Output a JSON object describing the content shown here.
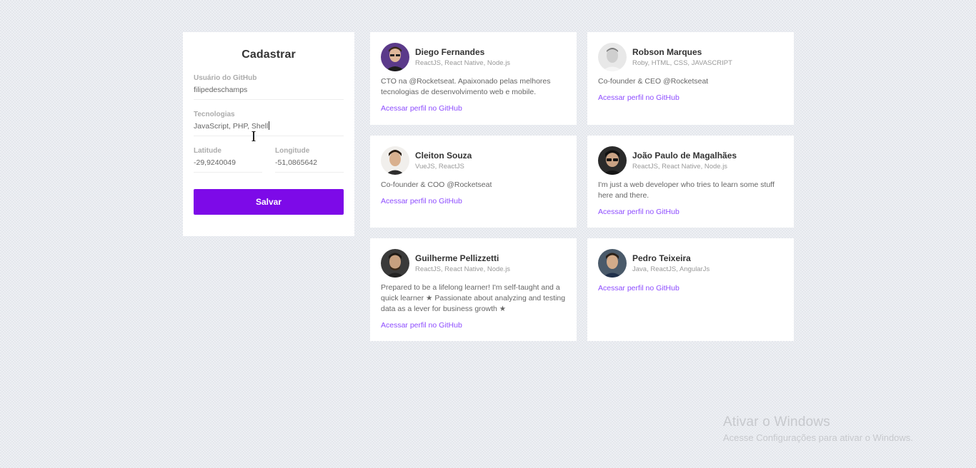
{
  "form": {
    "title": "Cadastrar",
    "github_user_label": "Usuário do GitHub",
    "github_user_value": "filipedeschamps",
    "techs_label": "Tecnologias",
    "techs_value": "JavaScript, PHP, Shell",
    "latitude_label": "Latitude",
    "latitude_value": "-29,9240049",
    "longitude_label": "Longitude",
    "longitude_value": "-51,0865642",
    "save_label": "Salvar"
  },
  "devs": [
    {
      "name": "Diego Fernandes",
      "techs": "ReactJS, React Native, Node.js",
      "bio": "CTO na @Rocketseat. Apaixonado pelas melhores tecnologias de desenvolvimento web e mobile.",
      "link": "Acessar perfil no GitHub"
    },
    {
      "name": "Robson Marques",
      "techs": "Roby, HTML, CSS, JAVASCRIPT",
      "bio": "Co-founder & CEO @Rocketseat",
      "link": "Acessar perfil no GitHub"
    },
    {
      "name": "Cleiton Souza",
      "techs": "VueJS, ReactJS",
      "bio": "Co-founder & COO @Rocketseat",
      "link": "Acessar perfil no GitHub"
    },
    {
      "name": "João Paulo de Magalhães",
      "techs": "ReactJS, React Native, Node.js",
      "bio": "I'm just a web developer who tries to learn some stuff here and there.",
      "link": "Acessar perfil no GitHub"
    },
    {
      "name": "Guilherme Pellizzetti",
      "techs": "ReactJS, React Native, Node.js",
      "bio": "Prepared to be a lifelong learner! I'm self-taught and a quick learner ★ Passionate about analyzing and testing data as a lever for business growth ★",
      "link": "Acessar perfil no GitHub"
    },
    {
      "name": "Pedro Teixeira",
      "techs": "Java, ReactJS, AngularJs",
      "bio": "",
      "link": "Acessar perfil no GitHub"
    }
  ],
  "colors": {
    "accent": "#7d0ae8",
    "link": "#8e4dff"
  },
  "watermark": {
    "title": "Ativar o Windows",
    "subtitle": "Acesse Configurações para ativar o Windows."
  }
}
